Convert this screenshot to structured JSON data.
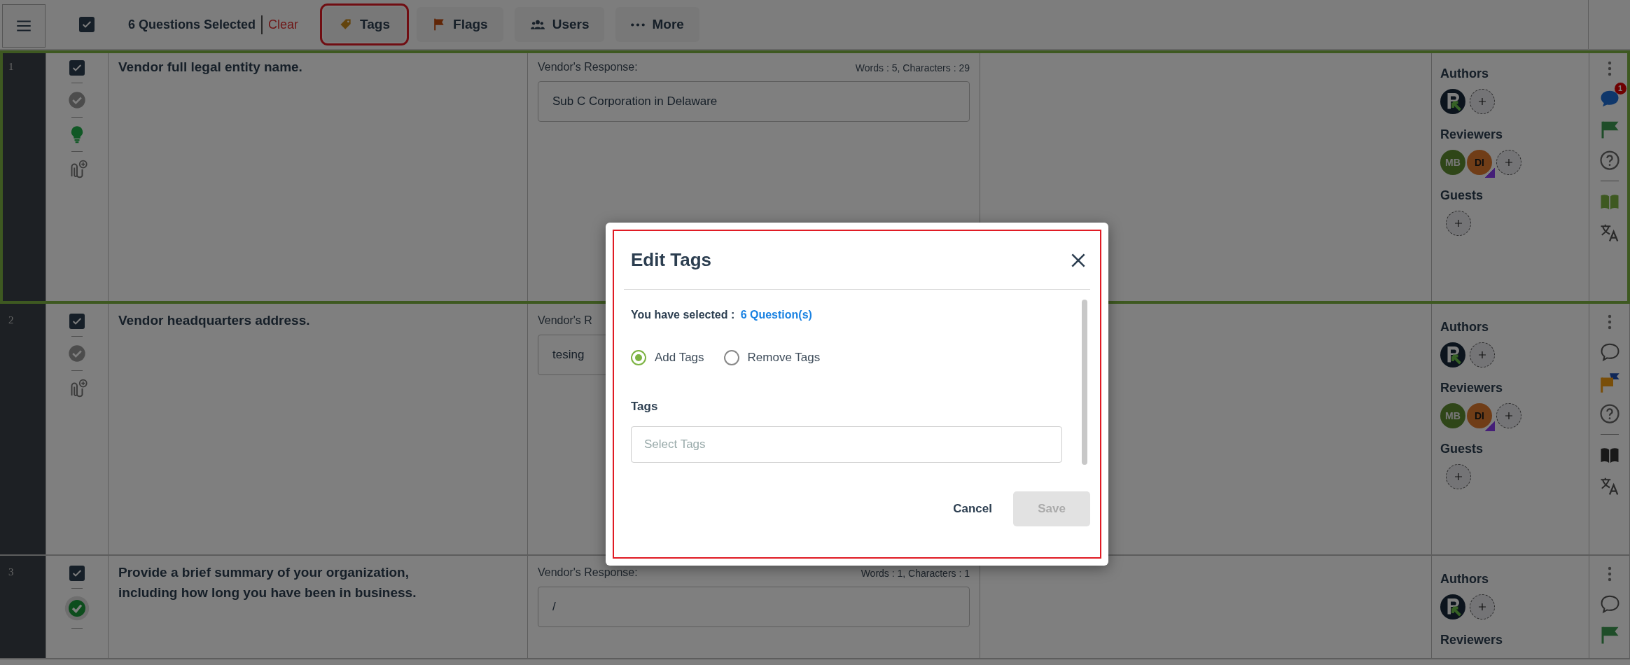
{
  "toolbar": {
    "all_checked": true,
    "selection_text": "6 Questions Selected",
    "clear": "Clear",
    "buttons": [
      {
        "kind": "tag",
        "label": "Tags",
        "highlighted": true
      },
      {
        "kind": "flag",
        "label": "Flags",
        "highlighted": false
      },
      {
        "kind": "users",
        "label": "Users",
        "highlighted": false
      },
      {
        "kind": "more",
        "label": "More",
        "highlighted": false
      }
    ]
  },
  "rows": [
    {
      "number": "1",
      "selected": true,
      "checked": true,
      "approved": false,
      "hint": true,
      "question": "Vendor full legal entity name.",
      "response": {
        "label": "Vendor's Response:",
        "counter": "Words : 5, Characters : 29",
        "value": "Sub C Corporation in Delaware"
      },
      "people": [
        {
          "role": "Authors",
          "members": [
            {
              "kind": "logo"
            }
          ]
        },
        {
          "role": "Reviewers",
          "members": [
            {
              "kind": "initials",
              "initials": "MB",
              "marked": false
            },
            {
              "kind": "initials",
              "initials": "DI",
              "marked": true
            }
          ]
        },
        {
          "role": "Guests"
        }
      ],
      "actions": {
        "comments": true,
        "comment_count": "1",
        "flag_raised": false,
        "glossary": true
      }
    },
    {
      "number": "2",
      "selected": false,
      "checked": true,
      "approved": false,
      "hint": false,
      "question": "Vendor headquarters address.",
      "response": {
        "label": "Vendor's R",
        "value": "tesing"
      },
      "people": [
        {
          "role": "Authors",
          "members": [
            {
              "kind": "logo"
            }
          ]
        },
        {
          "role": "Reviewers",
          "members": [
            {
              "kind": "initials",
              "initials": "MB",
              "marked": false
            },
            {
              "kind": "initials",
              "initials": "DI",
              "marked": true
            }
          ]
        },
        {
          "role": "Guests"
        }
      ],
      "actions": {
        "comments": false,
        "flag_raised": true,
        "glossary": false
      }
    },
    {
      "number": "3",
      "selected": false,
      "checked": true,
      "approved": true,
      "hint": false,
      "question": "Provide a brief summary of your organization, including how long you have been in business.",
      "response": {
        "label": "Vendor's Response:",
        "counter": "Words : 1, Characters : 1",
        "value": "/"
      },
      "people": [
        {
          "role": "Authors",
          "members": [
            {
              "kind": "logo"
            }
          ]
        },
        {
          "role": "Reviewers"
        }
      ],
      "actions": {
        "comments": false,
        "flag_raised": false
      }
    }
  ],
  "modal": {
    "highlighted": true,
    "title": "Edit Tags",
    "selected_label": "You have selected :",
    "selected_link": "6 Question(s)",
    "options": [
      {
        "label": "Add Tags",
        "selected": true
      },
      {
        "label": "Remove Tags",
        "selected": false
      }
    ],
    "tags_label": "Tags",
    "tags_placeholder": "Select Tags",
    "cancel": "Cancel",
    "save": "Save",
    "save_disabled": true
  }
}
